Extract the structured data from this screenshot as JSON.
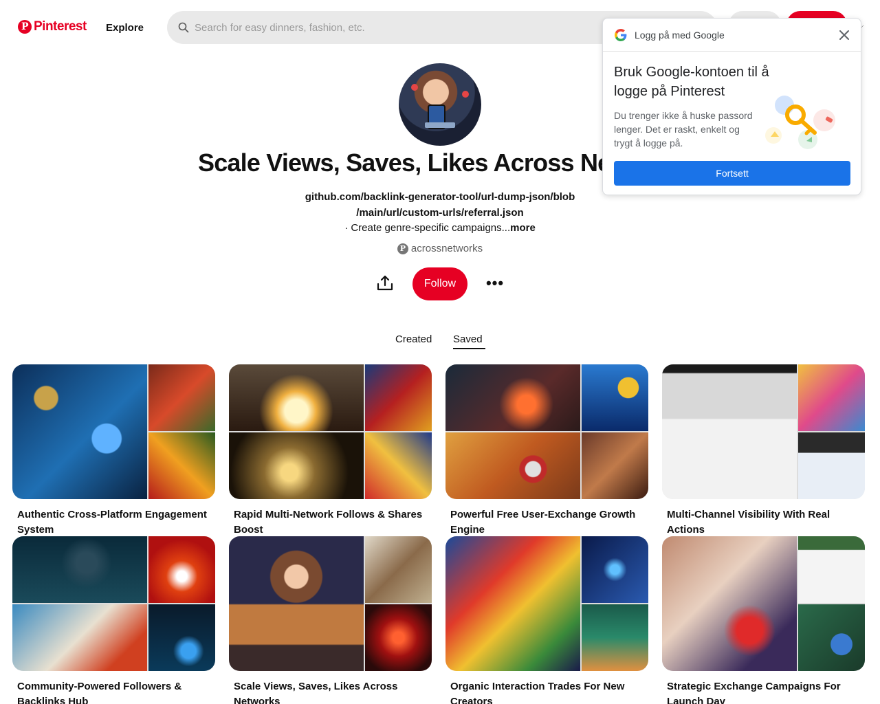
{
  "header": {
    "logo_text": "Pinterest",
    "logo_letter": "P",
    "explore_label": "Explore",
    "search_placeholder": "Search for easy dinners, fashion, etc."
  },
  "profile": {
    "title": "Scale Views, Saves, Likes Across Ne",
    "desc_line1": "github.com/backlink-generator-tool/url-dump-json/blob",
    "desc_line2": "/main/url/custom-urls/referral.json",
    "desc_line3": "· Create genre-specific campaigns...",
    "desc_more": "more",
    "username": "acrossnetworks",
    "follow_label": "Follow",
    "more_label": "•••"
  },
  "tabs": [
    {
      "label": "Created",
      "active": false
    },
    {
      "label": "Saved",
      "active": true
    }
  ],
  "boards": [
    {
      "title": "Authentic Cross-Platform Engagement System"
    },
    {
      "title": "Rapid Multi-Network Follows & Shares Boost"
    },
    {
      "title": "Powerful Free User-Exchange Growth Engine"
    },
    {
      "title": "Multi-Channel Visibility With Real Actions"
    },
    {
      "title": "Community-Powered Followers & Backlinks Hub"
    },
    {
      "title": "Scale Views, Saves, Likes Across Networks"
    },
    {
      "title": "Organic Interaction Trades For New Creators"
    },
    {
      "title": "Strategic Exchange Campaigns For Launch Day"
    }
  ],
  "google_popup": {
    "header_text": "Logg på med Google",
    "title": "Bruk Google-kontoen til å logge på Pinterest",
    "body": "Du trenger ikke å huske passord lenger. Det er raskt, enkelt og trygt å logge på.",
    "button_label": "Fortsett"
  },
  "colors": {
    "brand_red": "#e60023",
    "google_blue": "#1a73e8"
  }
}
